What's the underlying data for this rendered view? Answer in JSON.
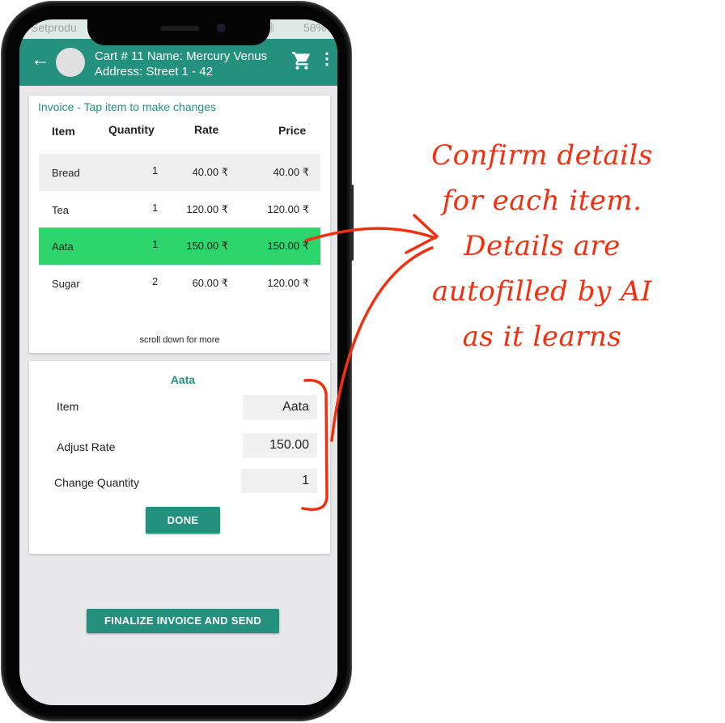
{
  "status_bar": {
    "carrier": "Setprodu",
    "battery": "58%"
  },
  "app_bar": {
    "cart_title": "Cart # 11 Name: Mercury Venus",
    "address": "Address: Street 1 - 42",
    "icons": [
      "back-arrow-icon",
      "cart-icon",
      "more-vert-icon"
    ],
    "color": "#23917d"
  },
  "invoice": {
    "title": "Invoice - Tap item to make changes",
    "columns": [
      "Item",
      "Quantity",
      "Rate",
      "Price"
    ],
    "rows": [
      {
        "item": "Bread",
        "qty": "1",
        "rate": "40.00 ₹",
        "price": "40.00 ₹"
      },
      {
        "item": "Tea",
        "qty": "1",
        "rate": "120.00 ₹",
        "price": "120.00 ₹"
      },
      {
        "item": "Aata",
        "qty": "1",
        "rate": "150.00 ₹",
        "price": "150.00 ₹"
      },
      {
        "item": "Sugar",
        "qty": "2",
        "rate": "60.00 ₹",
        "price": "120.00 ₹"
      }
    ],
    "selected_row": "Aata",
    "selected_color": "#2ed46c",
    "scroll_hint": "scroll down for more"
  },
  "edit_panel": {
    "title": "Aata",
    "item_label": "Item",
    "item_value": "Aata",
    "rate_label": "Adjust Rate",
    "rate_value": "150.00",
    "qty_label": "Change Quantity",
    "qty_value": "1",
    "done_label": "DONE"
  },
  "finalize_label": "FINALIZE INVOICE AND SEND",
  "annotation": {
    "lines": [
      "Confirm details",
      "for each item.",
      "Details are",
      "autofilled by AI",
      "as it learns"
    ],
    "color": "#f2300f"
  }
}
